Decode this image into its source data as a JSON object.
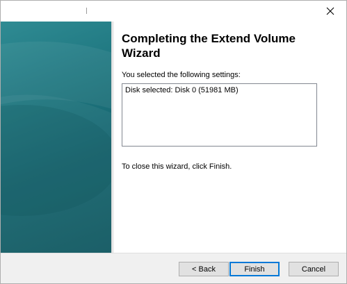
{
  "wizard": {
    "title": "Completing the Extend Volume Wizard",
    "settings_label": "You selected the following settings:",
    "settings": [
      "Disk selected: Disk 0 (51981 MB)"
    ],
    "close_instruction": "To close this wizard, click Finish."
  },
  "buttons": {
    "back": "< Back",
    "finish": "Finish",
    "cancel": "Cancel"
  },
  "colors": {
    "banner": "#1f7780",
    "default_button_border": "#0078d7"
  },
  "icons": {
    "close": "close-icon"
  }
}
